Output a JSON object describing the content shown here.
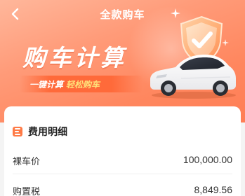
{
  "nav": {
    "title": "全款购车"
  },
  "hero": {
    "headline": "购车计算",
    "tagline_part1": "一键计算",
    "tagline_part2": "轻松购车"
  },
  "colors": {
    "accent": "#ff7a45",
    "hero_start": "#ffb79b",
    "hero_end": "#ff7e55"
  },
  "icons": [
    "back-arrow-icon",
    "shield-check-icon",
    "sparkle-icon",
    "car-illustration",
    "list-icon"
  ],
  "fee_detail": {
    "title": "费用明细",
    "rows": [
      {
        "label": "裸车价",
        "value": "100,000.00"
      },
      {
        "label": "购置税",
        "value": "8,849.56"
      }
    ]
  }
}
